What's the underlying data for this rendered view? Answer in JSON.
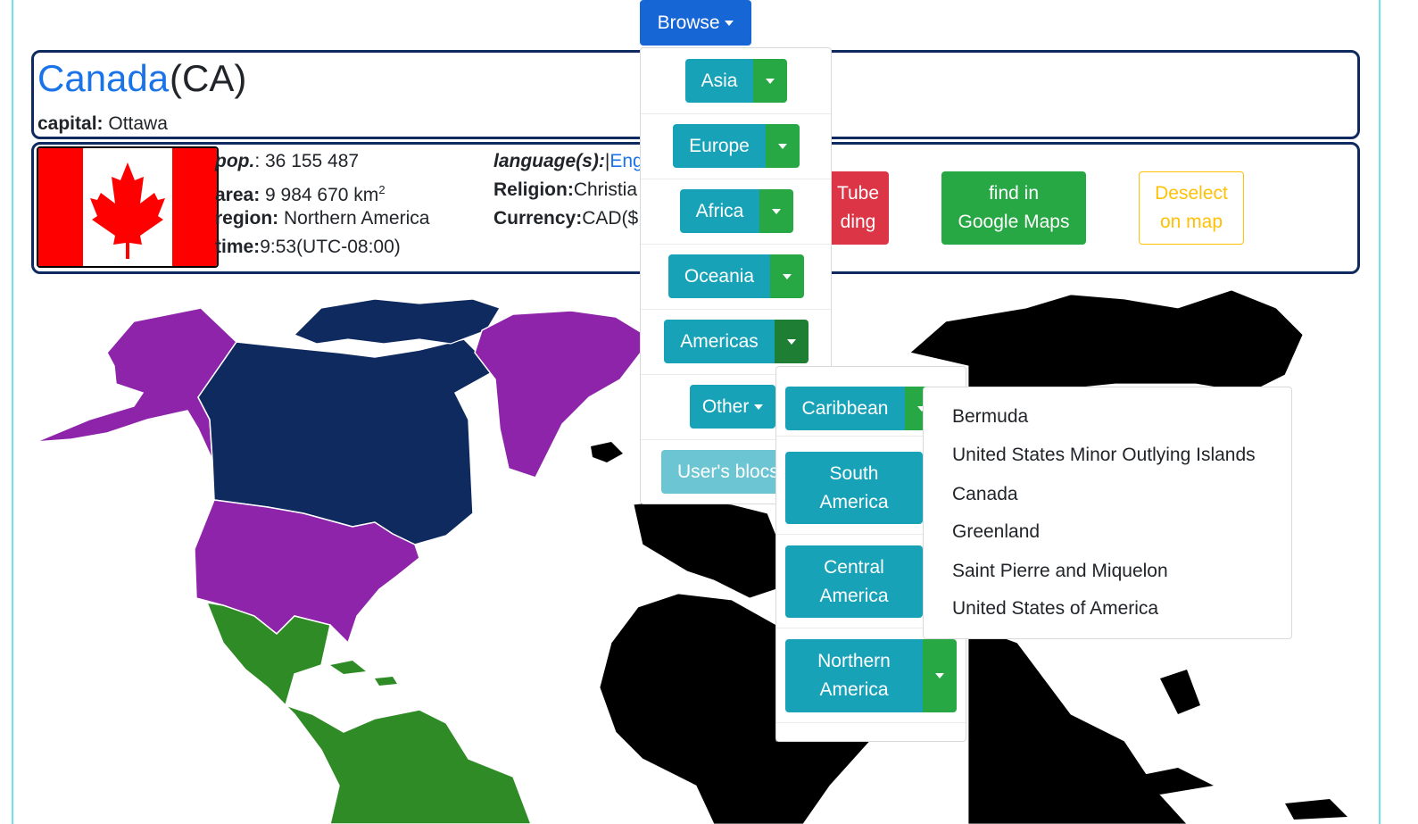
{
  "browse_label": "Browse",
  "country": {
    "name": "Canada",
    "code": "(CA)",
    "capital_label": "capital:",
    "capital": "Ottawa",
    "pop_label": "pop.",
    "pop_value": ": 36 155 487",
    "area_label": "area:",
    "area_value": "9 984 670 km",
    "area_sup": "2",
    "region_label": "region:",
    "region_value": "Northern America",
    "time_label": "time:",
    "time_value": "9:53(UTC-08:00)",
    "language_label": "language(s):",
    "language_sep": "|",
    "language_value": "Eng",
    "religion_label": "Religion:",
    "religion_value": "Christia",
    "currency_label": "Currency:",
    "currency_value": "CAD($"
  },
  "actions": {
    "youtube_label_1": "Tube",
    "youtube_label_2": "ding",
    "maps_label_1": "find in",
    "maps_label_2": "Google Maps",
    "deselect_label_1": "Deselect",
    "deselect_label_2": "on map"
  },
  "regions": [
    "Asia",
    "Europe",
    "Africa",
    "Oceania",
    "Americas",
    "Other",
    "User's blocs"
  ],
  "americas_sub": [
    "Caribbean",
    "South America",
    "Central America",
    "Northern America"
  ],
  "americas_sub_lines": {
    "south_1": "South",
    "south_2": "America",
    "central_1": "Central",
    "central_2": "America",
    "northern_1": "Northern",
    "northern_2": "America"
  },
  "countries_list": [
    "Bermuda",
    "United States Minor Outlying Islands",
    "Canada",
    "Greenland",
    "Saint Pierre and Miquelon",
    "United States of America"
  ],
  "colors": {
    "selected_region": "#0f2a5f",
    "highlighted_region": "#8e24aa",
    "other_americas": "#2e8b25",
    "rest_of_world": "#000000"
  }
}
